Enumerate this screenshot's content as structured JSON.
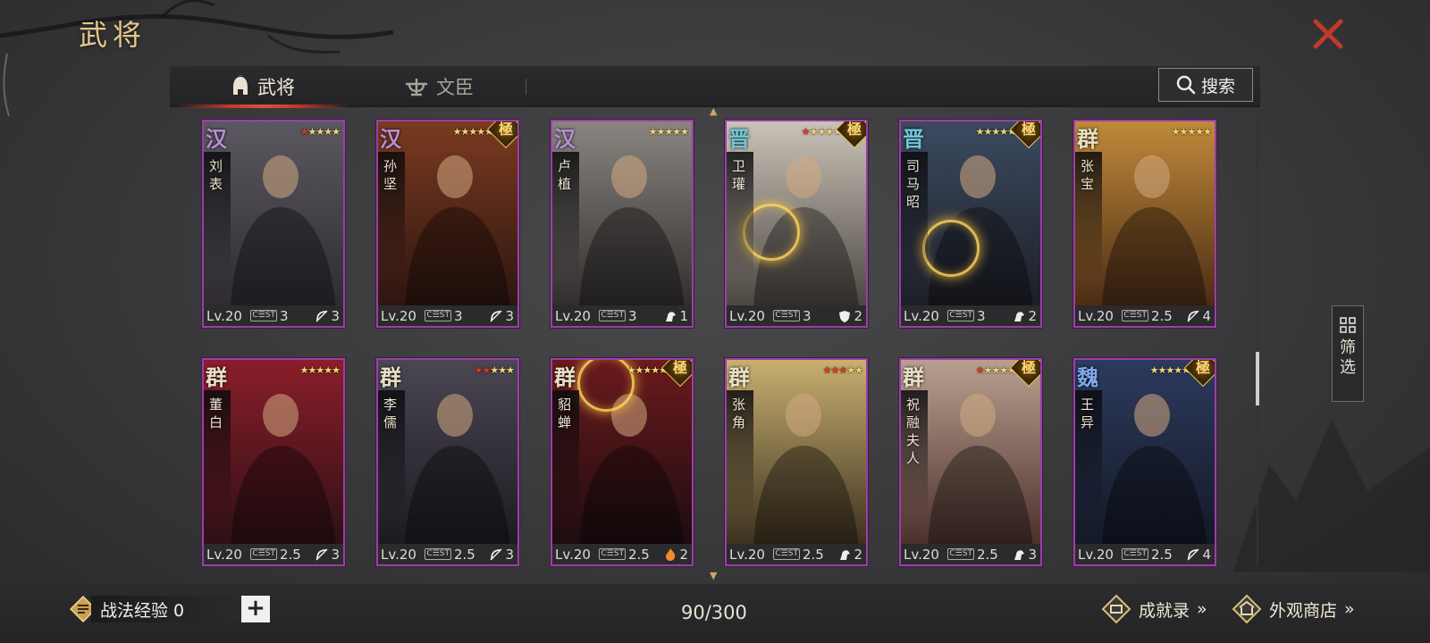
{
  "header": {
    "title": "武将"
  },
  "tabs": [
    {
      "label": "武将",
      "active": true,
      "icon": "helmet-icon"
    },
    {
      "label": "文臣",
      "active": false,
      "icon": "official-hat-icon"
    }
  ],
  "search": {
    "label": "搜索",
    "icon": "search-icon"
  },
  "colors": {
    "accent_gold": "#e3c88a",
    "card_border": "#9b3fa6",
    "close_red": "#c0392b",
    "star_red": "#e03a22",
    "star_gold": "#f1d67a"
  },
  "cards": [
    {
      "faction": "汉",
      "faction_color": "#b88dd8",
      "name": "刘表",
      "stars_red": 1,
      "stars_total": 5,
      "ji": false,
      "level": "Lv.20",
      "cost": "3",
      "arm_value": "3",
      "arm_icon": "bow-icon",
      "tone": [
        "#5b5860",
        "#2e2b30"
      ],
      "glow": false
    },
    {
      "faction": "汉",
      "faction_color": "#b88dd8",
      "name": "孙坚",
      "stars_red": 0,
      "stars_total": 5,
      "ji": true,
      "level": "Lv.20",
      "cost": "3",
      "arm_value": "3",
      "arm_icon": "bow-icon",
      "tone": [
        "#7a3a20",
        "#2c1510"
      ],
      "glow": false
    },
    {
      "faction": "汉",
      "faction_color": "#b88dd8",
      "name": "卢植",
      "stars_red": 0,
      "stars_total": 5,
      "ji": false,
      "level": "Lv.20",
      "cost": "3",
      "arm_value": "1",
      "arm_icon": "cavalry-icon",
      "tone": [
        "#8a8580",
        "#2f2c2c"
      ],
      "glow": false
    },
    {
      "faction": "晋",
      "faction_color": "#6fc6d6",
      "name": "卫瓘",
      "stars_red": 1,
      "stars_total": 5,
      "ji": true,
      "level": "Lv.20",
      "cost": "3",
      "arm_value": "2",
      "arm_icon": "shield-icon",
      "tone": [
        "#c9c3b8",
        "#4a4440"
      ],
      "glow": true
    },
    {
      "faction": "晋",
      "faction_color": "#6fc6d6",
      "name": "司马昭",
      "stars_red": 0,
      "stars_total": 5,
      "ji": true,
      "level": "Lv.20",
      "cost": "3",
      "arm_value": "2",
      "arm_icon": "cavalry-icon",
      "tone": [
        "#3c4a60",
        "#1c1e26"
      ],
      "glow": true
    },
    {
      "faction": "群",
      "faction_color": "#e8e0c8",
      "name": "张宝",
      "stars_red": 0,
      "stars_total": 5,
      "ji": false,
      "level": "Lv.20",
      "cost": "2.5",
      "arm_value": "4",
      "arm_icon": "bow-icon",
      "tone": [
        "#c08a3a",
        "#4a2a14"
      ],
      "glow": false
    },
    {
      "faction": "群",
      "faction_color": "#e8e0c8",
      "name": "董白",
      "stars_red": 0,
      "stars_total": 5,
      "ji": false,
      "level": "Lv.20",
      "cost": "2.5",
      "arm_value": "3",
      "arm_icon": "bow-icon",
      "tone": [
        "#8a1e2a",
        "#2c1014"
      ],
      "glow": false
    },
    {
      "faction": "群",
      "faction_color": "#e8e0c8",
      "name": "李儒",
      "stars_red": 2,
      "stars_total": 5,
      "ji": false,
      "level": "Lv.20",
      "cost": "2.5",
      "arm_value": "3",
      "arm_icon": "bow-icon",
      "tone": [
        "#4a4652",
        "#1c1a20"
      ],
      "glow": false
    },
    {
      "faction": "群",
      "faction_color": "#e8e0c8",
      "name": "貂蝉",
      "stars_red": 0,
      "stars_total": 5,
      "ji": true,
      "level": "Lv.20",
      "cost": "2.5",
      "arm_value": "2",
      "arm_icon": "fire-icon",
      "tone": [
        "#6a1a1c",
        "#1c0c10"
      ],
      "glow": true
    },
    {
      "faction": "群",
      "faction_color": "#e8e0c8",
      "name": "张角",
      "stars_red": 3,
      "stars_total": 5,
      "ji": false,
      "level": "Lv.20",
      "cost": "2.5",
      "arm_value": "2",
      "arm_icon": "cavalry-icon",
      "tone": [
        "#c8b070",
        "#3a2e1e"
      ],
      "glow": false
    },
    {
      "faction": "群",
      "faction_color": "#e8e0c8",
      "name": "祝融夫人",
      "stars_red": 1,
      "stars_total": 5,
      "ji": true,
      "level": "Lv.20",
      "cost": "2.5",
      "arm_value": "3",
      "arm_icon": "cavalry-icon",
      "tone": [
        "#b8a090",
        "#4a2e2a"
      ],
      "glow": false
    },
    {
      "faction": "魏",
      "faction_color": "#7fa8e8",
      "name": "王异",
      "stars_red": 0,
      "stars_total": 5,
      "ji": true,
      "level": "Lv.20",
      "cost": "2.5",
      "arm_value": "4",
      "arm_icon": "bow-icon",
      "tone": [
        "#2c3a5c",
        "#141826"
      ],
      "glow": false
    }
  ],
  "cost_icon_label": "C☰ST",
  "ji_label": "極",
  "filter": {
    "label": "筛选",
    "icon": "grid-filter-icon"
  },
  "footer": {
    "exp_label": "战法经验 0",
    "plus_label": "+",
    "count": "90/300",
    "achievements_label": "成就录",
    "shop_label": "外观商店",
    "chevrons": "»"
  }
}
